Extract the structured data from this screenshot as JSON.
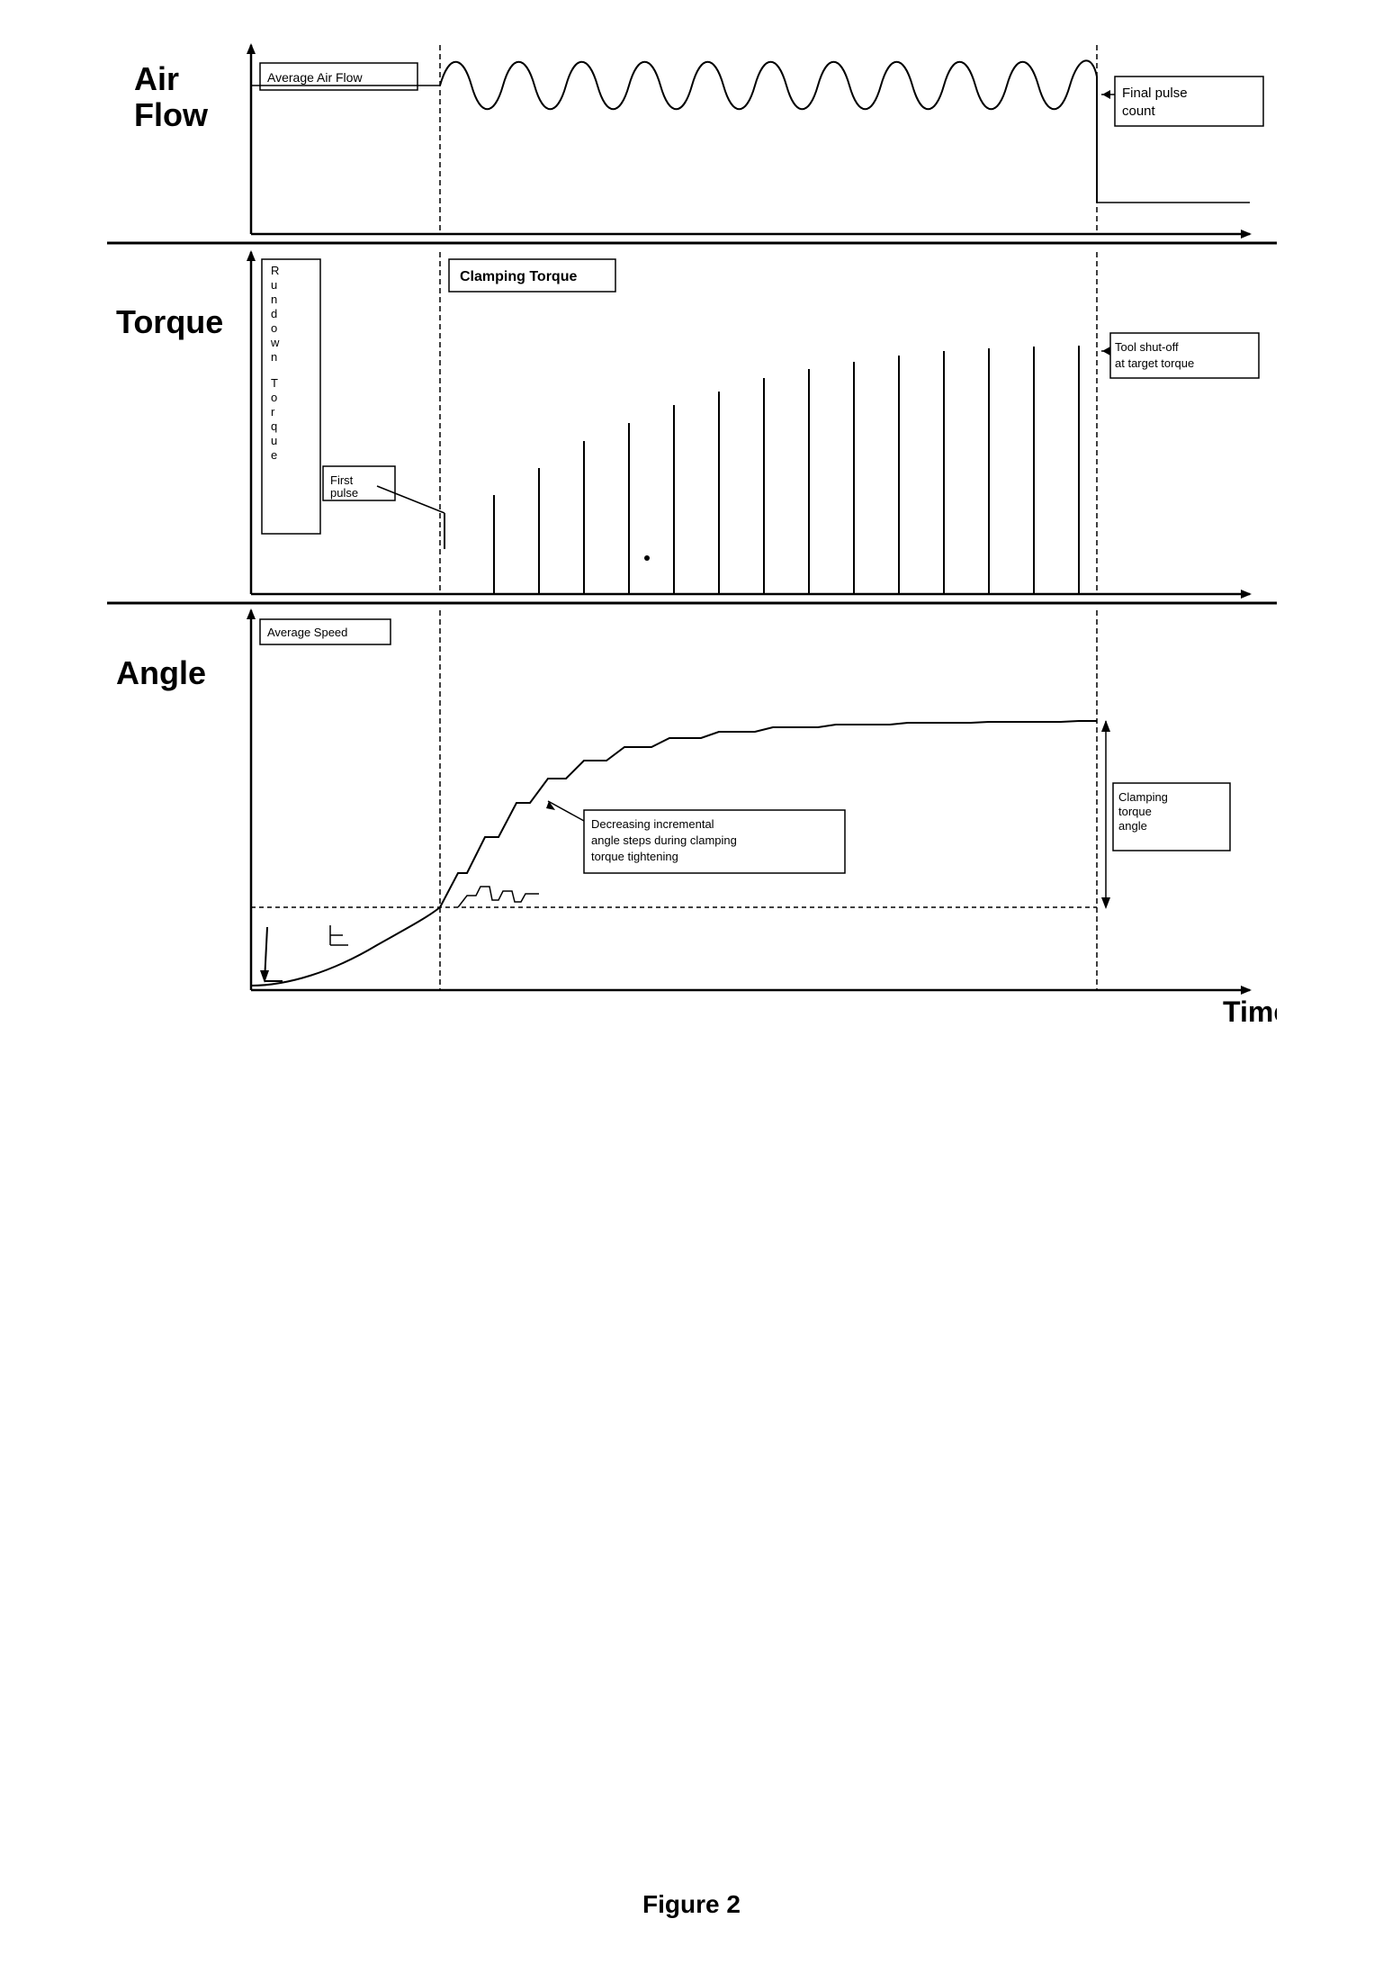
{
  "figure": {
    "caption": "Figure 2",
    "sections": {
      "air_flow": {
        "label": "Air\nFlow",
        "annotations": {
          "average_air_flow": "Average Air Flow",
          "final_pulse_count": "Final pulse count"
        }
      },
      "torque": {
        "label": "Torque",
        "annotations": {
          "rundown_torque": "R\nu\nn\nd\no\nw\nn\n\nT\no\nr\nq\nu\ne",
          "clamping_torque": "Clamping Torque",
          "first_pulse": "First\npulse",
          "tool_shutoff": "Tool shut-off\nat target torque"
        }
      },
      "angle": {
        "label": "Angle",
        "annotations": {
          "average_speed": "Average Speed",
          "clamping_torque_angle": "Clamping\ntorque\nangle",
          "decreasing_steps": "Decreasing incremental\nangle steps during clamping\ntorque tightening"
        }
      }
    },
    "x_axis_label": "Time"
  }
}
